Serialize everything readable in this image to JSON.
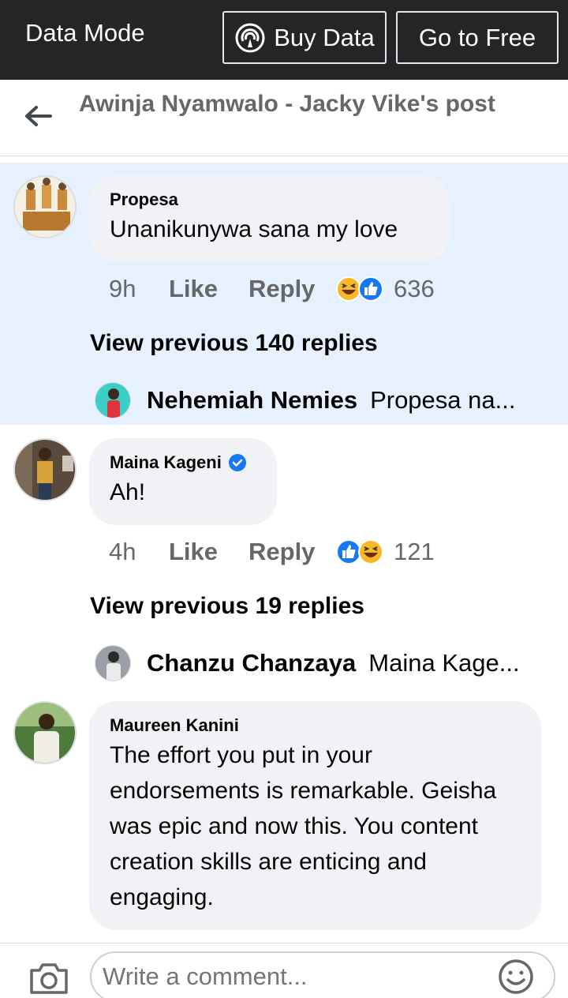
{
  "topbar": {
    "mode_label": "Data Mode",
    "buy_label": "Buy Data",
    "free_label": "Go to Free"
  },
  "header": {
    "title": "Awinja Nyamwalo - Jacky Vike's post"
  },
  "comments": [
    {
      "author": "Propesa",
      "text": "Unanikunywa sana my love",
      "time": "9h",
      "like": "Like",
      "reply": "Reply",
      "reaction_count": "636",
      "reactions": [
        "haha-icon",
        "like-icon"
      ],
      "view_previous": "View previous 140 replies",
      "preview_author": "Nehemiah Nemies",
      "preview_text": "Propesa na..."
    },
    {
      "author": "Maina Kageni",
      "text": "Ah!",
      "time": "4h",
      "like": "Like",
      "reply": "Reply",
      "reaction_count": "121",
      "reactions": [
        "like-icon",
        "haha-icon"
      ],
      "view_previous": "View previous 19 replies",
      "preview_author": "Chanzu Chanzaya",
      "preview_text": "Maina Kage..."
    },
    {
      "author": "Maureen Kanini",
      "text": "The effort you put in your endorsements is remarkable. Geisha was epic and now this. You content creation skills are enticing and engaging."
    }
  ],
  "composer": {
    "placeholder": "Write a comment..."
  },
  "colors": {
    "topbar_bg": "#242526",
    "highlight_bg": "#e7f0fd",
    "bubble_bg": "#f0f2f5",
    "like_blue": "#1877f2",
    "haha_yellow": "#f7b928",
    "muted_text": "#65676b"
  }
}
